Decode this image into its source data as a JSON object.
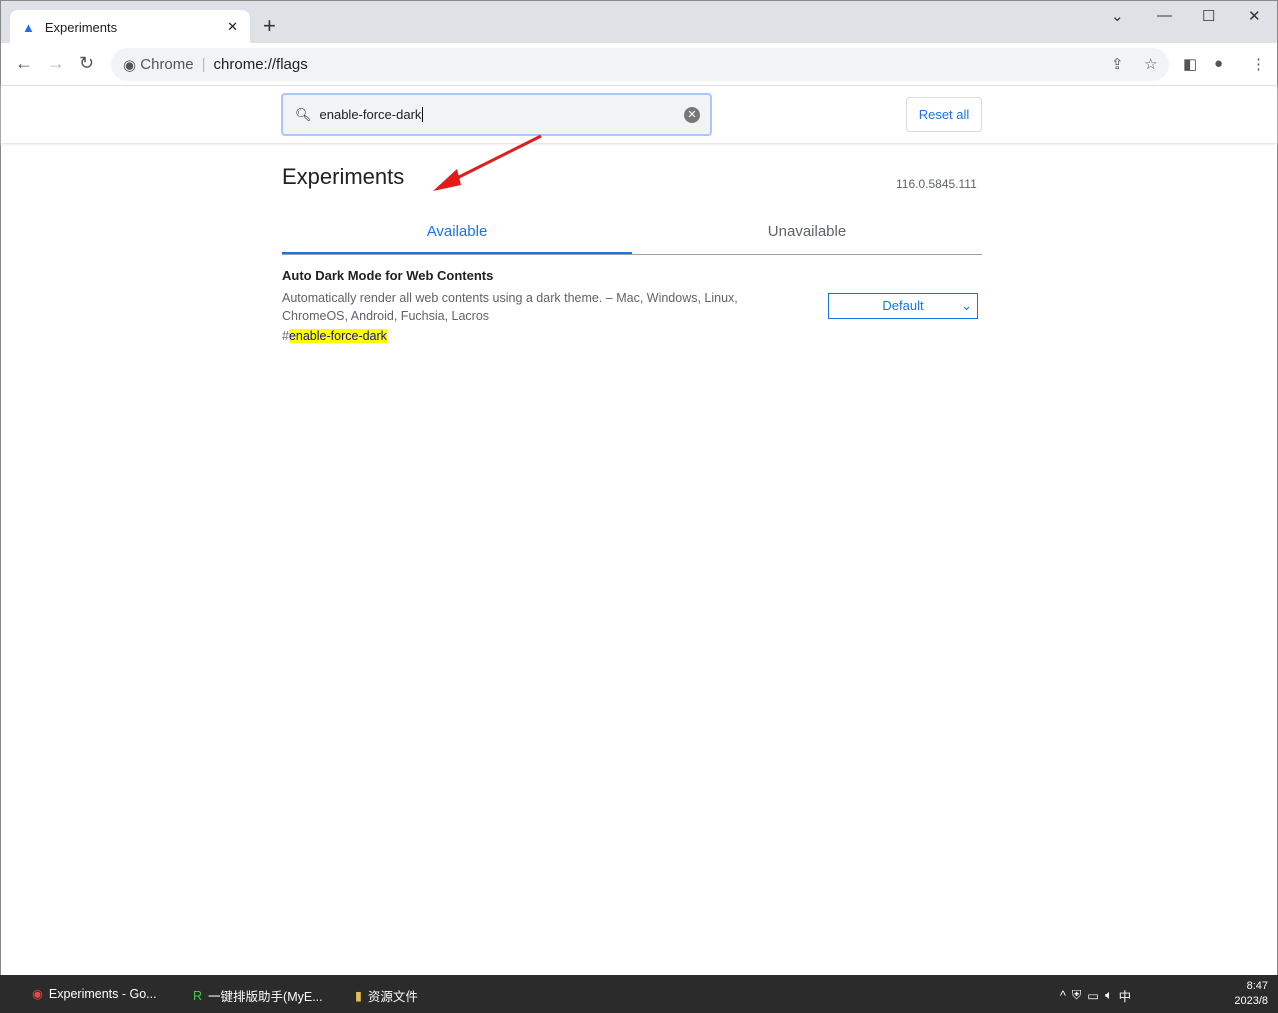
{
  "tab": {
    "title": "Experiments",
    "icon": "flask-icon"
  },
  "omnibox": {
    "site": "Chrome",
    "url": "chrome://flags"
  },
  "search": {
    "value": "enable-force-dark"
  },
  "reset_label": "Reset all",
  "title": "Experiments",
  "version": "116.0.5845.111",
  "tabs": [
    "Available",
    "Unavailable"
  ],
  "experiment": {
    "name": "Auto Dark Mode for Web Contents",
    "description": "Automatically render all web contents using a dark theme. – Mac, Windows, Linux, ChromeOS, Android, Fuchsia, Lacros",
    "hash": "#",
    "link": "enable-force-dark",
    "select": "Default"
  },
  "taskbar": {
    "items": [
      "Experiments - Go...",
      "一键排版助手(MyE...",
      "资源文件"
    ],
    "time": "8:47",
    "date": "2023/8",
    "ime": "中"
  },
  "colors": {
    "accent": "#1a73e8",
    "highlight": "#ffff00",
    "annotation_arrow": "#e31b1b"
  }
}
